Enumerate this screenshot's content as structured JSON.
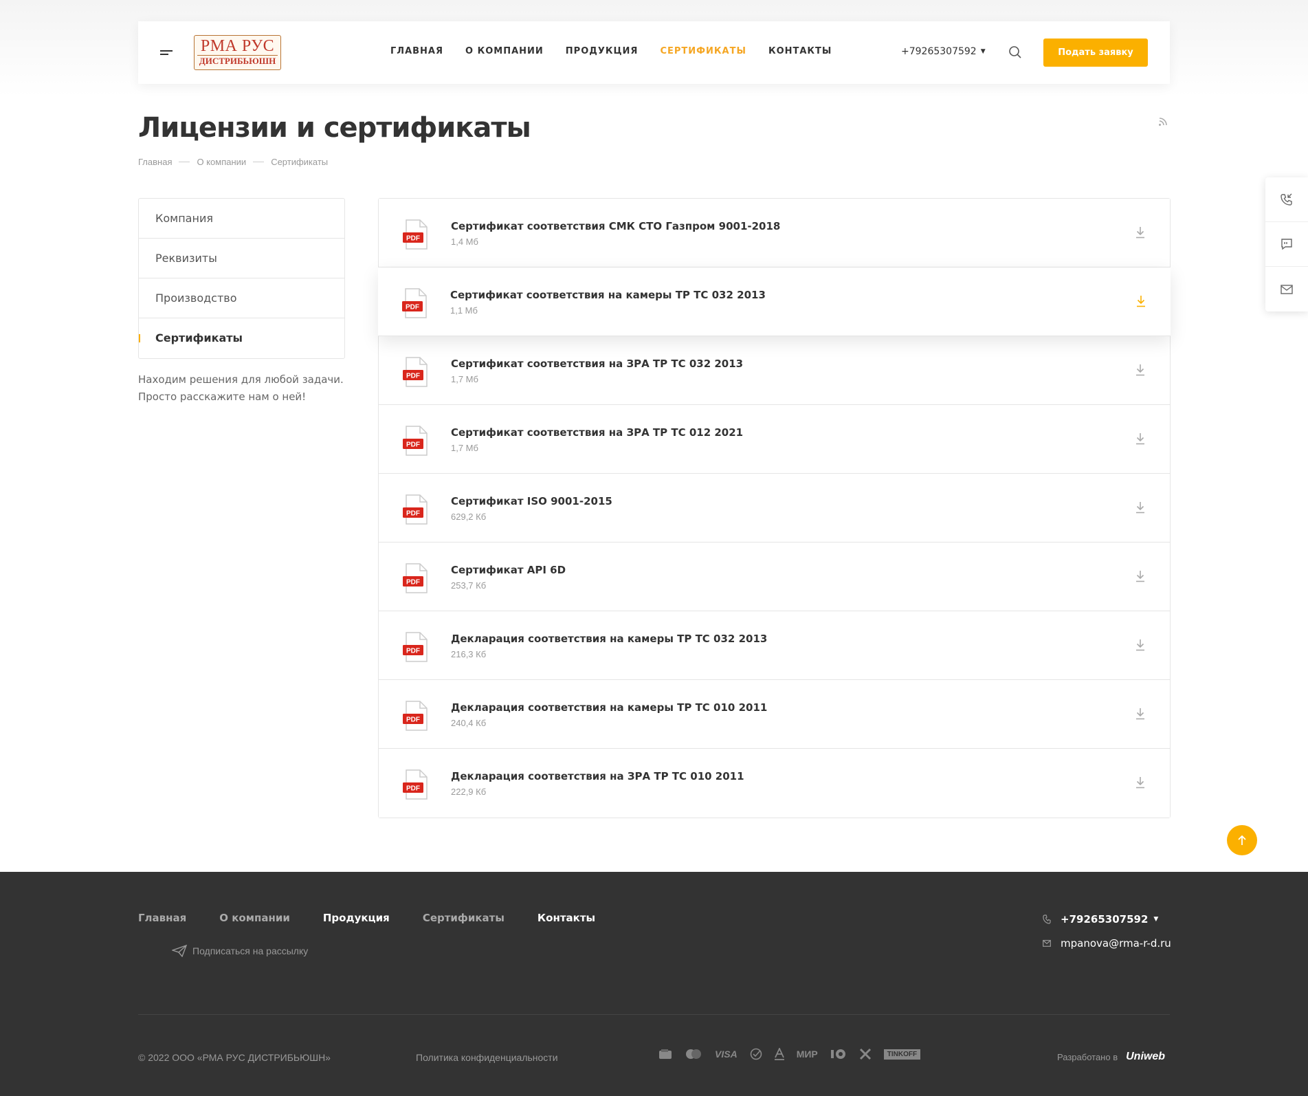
{
  "header": {
    "logo_line1": "РМА РУС",
    "logo_line2": "ДИСТРИБЬЮШН",
    "nav": [
      "Главная",
      "О компании",
      "Продукция",
      "Сертификаты",
      "Контакты"
    ],
    "active_nav": "Сертификаты",
    "phone": "+79265307592",
    "cta_label": "Подать заявку",
    "accent_color": "#fbb000"
  },
  "page": {
    "title": "Лицензии и сертификаты",
    "breadcrumbs": [
      "Главная",
      "О компании",
      "Сертификаты"
    ]
  },
  "sidebar": {
    "items": [
      {
        "label": "Компания"
      },
      {
        "label": "Реквизиты"
      },
      {
        "label": "Производство"
      },
      {
        "label": "Сертификаты"
      }
    ],
    "active": "Сертификаты",
    "text_line1": "Находим решения для любой задачи.",
    "text_line2": "Просто расскажите нам о ней!"
  },
  "documents": [
    {
      "title": "Сертификат соответствия СМК СТО Газпром 9001-2018",
      "size": "1,4 Мб",
      "icon": "pdf-icon"
    },
    {
      "title": "Сертификат соответствия на камеры ТР ТС 032 2013",
      "size": "1,1 Мб",
      "icon": "pdf-icon"
    },
    {
      "title": "Сертификат соответствия на ЗРА ТР ТС 032 2013",
      "size": "1,7 Мб",
      "icon": "pdf-icon"
    },
    {
      "title": "Сертификат соответствия на ЗРА ТР ТС 012 2021",
      "size": "1,7 Мб",
      "icon": "pdf-icon"
    },
    {
      "title": "Сертификат ISO 9001-2015",
      "size": "629,2 Кб",
      "icon": "pdf-icon"
    },
    {
      "title": "Сертификат API 6D",
      "size": "253,7 Кб",
      "icon": "pdf-icon"
    },
    {
      "title": "Декларация соответствия на камеры ТР ТС 032 2013",
      "size": "216,3 Кб",
      "icon": "pdf-icon"
    },
    {
      "title": "Декларация соответствия на камеры ТР ТС 010 2011",
      "size": "240,4 Кб",
      "icon": "pdf-icon"
    },
    {
      "title": "Декларация соответствия на ЗРА ТР ТС 010 2011",
      "size": "222,9 Кб",
      "icon": "pdf-icon"
    }
  ],
  "footer": {
    "nav": [
      "Главная",
      "О компании",
      "Продукция",
      "Сертификаты",
      "Контакты"
    ],
    "subscribe": "Подписаться на рассылку",
    "phone": "+79265307592",
    "email": "mpanova@rma-r-d.ru",
    "copyright": "© 2022 ООО «РМА РУС ДИСТРИБЬЮШН»",
    "policy": "Политика конфиденциальности",
    "payments": [
      "visa",
      "мир",
      "tinkoff"
    ],
    "developed_by": "Разработано в",
    "developer": "Uniweb"
  }
}
